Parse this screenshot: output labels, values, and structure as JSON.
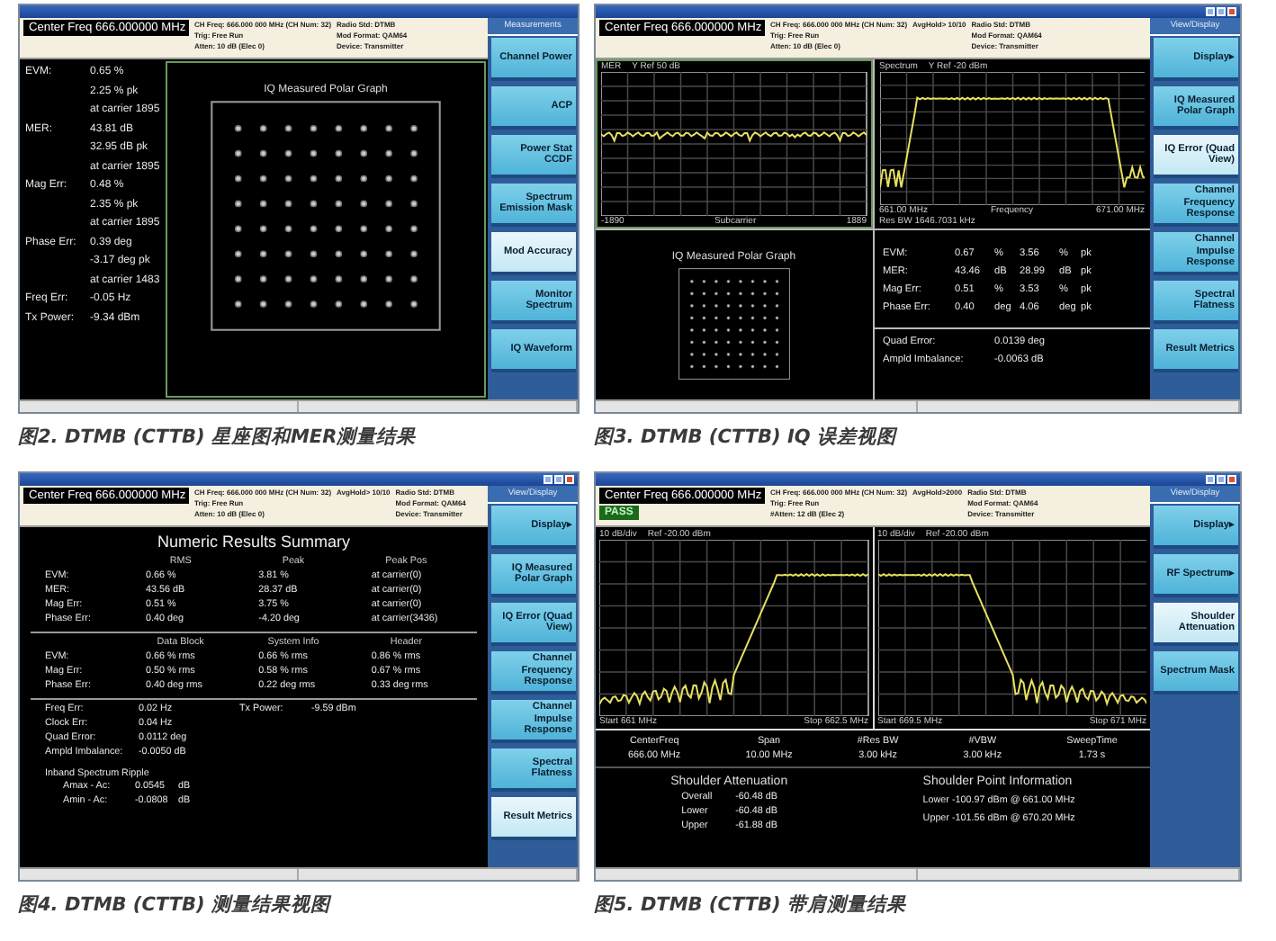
{
  "figures": [
    {
      "caption": "图2. DTMB (CTTB) 星座图和MER测量结果",
      "window_buttons": false,
      "header": {
        "center_freq": "Center Freq  666.000000 MHz",
        "info": [
          [
            "CH Freq: 666.000 000 MHz (CH Num: 32)",
            "Trig: Free Run",
            "Atten: 10 dB (Elec 0)"
          ],
          [
            "Radio Std: DTMB",
            "Mod Format: QAM64",
            "Device: Transmitter"
          ]
        ]
      },
      "softkeys_title": "Measurements",
      "softkeys": [
        {
          "label": "Channel Power",
          "selected": false
        },
        {
          "label": "ACP",
          "selected": false
        },
        {
          "label": "Power Stat CCDF",
          "selected": false
        },
        {
          "label": "Spectrum Emission Mask",
          "selected": false
        },
        {
          "label": "Mod Accuracy",
          "selected": true
        },
        {
          "label": "Monitor Spectrum",
          "selected": false
        },
        {
          "label": "IQ Waveform",
          "selected": false
        }
      ],
      "body": {
        "kind": "mod_accuracy",
        "graph_title": "IQ Measured Polar Graph",
        "metrics": [
          {
            "label": "EVM:",
            "values": [
              "0.65 %",
              "2.25 % pk",
              "at carrier 1895"
            ]
          },
          {
            "label": "MER:",
            "values": [
              "43.81 dB",
              "32.95 dB pk",
              "at carrier 1895"
            ]
          },
          {
            "label": "Mag Err:",
            "values": [
              "0.48 %",
              "2.35 % pk",
              "at carrier 1895"
            ]
          },
          {
            "label": "Phase Err:",
            "values": [
              "0.39 deg",
              "-3.17 deg pk",
              "at carrier 1483"
            ]
          },
          {
            "label": "Freq Err:",
            "values": [
              "-0.05 Hz"
            ]
          },
          {
            "label": "Tx Power:",
            "values": [
              "-9.34 dBm"
            ]
          }
        ]
      }
    },
    {
      "caption": "图3. DTMB (CTTB) IQ 误差视图",
      "window_buttons": true,
      "header": {
        "center_freq": "Center Freq  666.000000 MHz",
        "info": [
          [
            "CH Freq: 666.000 000 MHz (CH Num: 32)",
            "Trig: Free Run",
            "Atten: 10 dB (Elec 0)"
          ],
          [
            "AvgHold> 10/10"
          ],
          [
            "Radio Std: DTMB",
            "Mod Format: QAM64",
            "Device: Transmitter"
          ]
        ]
      },
      "softkeys_title": "View/Display",
      "softkeys": [
        {
          "label": "Display▸",
          "selected": false
        },
        {
          "label": "IQ Measured Polar Graph",
          "selected": false
        },
        {
          "label": "IQ Error (Quad View)",
          "selected": true
        },
        {
          "label": "Channel Frequency Response",
          "selected": false
        },
        {
          "label": "Channel Impulse Response",
          "selected": false
        },
        {
          "label": "Spectral Flatness",
          "selected": false
        },
        {
          "label": "Result Metrics",
          "selected": false
        }
      ],
      "body": {
        "kind": "quad_view",
        "graph_title": "IQ Measured Polar Graph",
        "plots": [
          {
            "title": "MER",
            "ref": "Y Ref 50 dB",
            "x_start": "-1890",
            "x_label": "Subcarrier",
            "x_stop": "1889",
            "kind": "flat"
          },
          {
            "title": "Spectrum",
            "ref": "Y Ref -20 dBm",
            "x_start": "661.00 MHz",
            "x_label": "Frequency",
            "x_stop": "671.00 MHz",
            "footer": "Res BW 1646.7031 kHz",
            "kind": "bandpass"
          }
        ],
        "table": [
          {
            "label": "EVM:",
            "cells": [
              "0.67",
              "%",
              "3.56",
              "%",
              "pk"
            ]
          },
          {
            "label": "MER:",
            "cells": [
              "43.46",
              "dB",
              "28.99",
              "dB",
              "pk"
            ]
          },
          {
            "label": "Mag Err:",
            "cells": [
              "0.51",
              "%",
              "3.53",
              "%",
              "pk"
            ]
          },
          {
            "label": "Phase Err:",
            "cells": [
              "0.40",
              "deg",
              "4.06",
              "deg",
              "pk"
            ]
          }
        ],
        "extra": [
          {
            "label": "Quad Error:",
            "value": "0.0139 deg"
          },
          {
            "label": "Ampld Imbalance:",
            "value": "-0.0063 dB"
          }
        ]
      }
    },
    {
      "caption": "图4. DTMB (CTTB) 测量结果视图",
      "window_buttons": true,
      "header": {
        "center_freq": "Center Freq  666.000000 MHz",
        "info": [
          [
            "CH Freq: 666.000 000 MHz (CH Num: 32)",
            "Trig: Free Run",
            "Atten: 10 dB (Elec 0)"
          ],
          [
            "AvgHold> 10/10"
          ],
          [
            "Radio Std: DTMB",
            "Mod Format: QAM64",
            "Device: Transmitter"
          ]
        ]
      },
      "softkeys_title": "View/Display",
      "softkeys": [
        {
          "label": "Display▸",
          "selected": false
        },
        {
          "label": "IQ Measured Polar Graph",
          "selected": false
        },
        {
          "label": "IQ Error (Quad View)",
          "selected": false
        },
        {
          "label": "Channel Frequency Response",
          "selected": false
        },
        {
          "label": "Channel Impulse Response",
          "selected": false
        },
        {
          "label": "Spectral Flatness",
          "selected": false
        },
        {
          "label": "Result Metrics",
          "selected": true
        }
      ],
      "body": {
        "kind": "summary",
        "title": "Numeric Results Summary",
        "tables": [
          {
            "columns": [
              "RMS",
              "Peak",
              "Peak Pos"
            ],
            "rows": [
              {
                "label": "EVM:",
                "cells": [
                  "0.66  %",
                  "3.81  %",
                  "at carrier(0)"
                ]
              },
              {
                "label": "MER:",
                "cells": [
                  "43.56  dB",
                  "28.37  dB",
                  "at carrier(0)"
                ]
              },
              {
                "label": "Mag Err:",
                "cells": [
                  "0.51  %",
                  "3.75  %",
                  "at carrier(0)"
                ]
              },
              {
                "label": "Phase Err:",
                "cells": [
                  "0.40  deg",
                  "-4.20  deg",
                  "at carrier(3436)"
                ]
              }
            ]
          },
          {
            "columns": [
              "Data Block",
              "System Info",
              "Header"
            ],
            "rows": [
              {
                "label": "EVM:",
                "cells": [
                  "0.66  % rms",
                  "0.66  % rms",
                  "0.86  % rms"
                ]
              },
              {
                "label": "Mag Err:",
                "cells": [
                  "0.50  % rms",
                  "0.58  % rms",
                  "0.67  % rms"
                ]
              },
              {
                "label": "Phase Err:",
                "cells": [
                  "0.40  deg rms",
                  "0.22  deg rms",
                  "0.33  deg rms"
                ]
              }
            ]
          }
        ],
        "misc": [
          {
            "label": "Freq Err:",
            "value": "0.02 Hz",
            "side_label": "Tx Power:",
            "side_value": "-9.59 dBm"
          },
          {
            "label": "Clock Err:",
            "value": "0.04 Hz"
          },
          {
            "label": "Quad Error:",
            "value": "0.0112 deg"
          },
          {
            "label": "Ampld Imbalance:",
            "value": "-0.0050 dB"
          }
        ],
        "ripple": {
          "title": "Inband Spectrum Ripple",
          "rows": [
            {
              "label": "Amax - Ac:",
              "value": "0.0545",
              "unit": "dB"
            },
            {
              "label": "Amin - Ac:",
              "value": "-0.0808",
              "unit": "dB"
            }
          ]
        }
      }
    },
    {
      "caption": "图5. DTMB (CTTB) 带肩测量结果",
      "window_buttons": true,
      "header": {
        "center_freq": "Center Freq  666.000000 MHz",
        "pass": "PASS",
        "info": [
          [
            "CH Freq: 666.000 000 MHz (CH Num: 32)",
            "Trig: Free Run",
            "#Atten: 12 dB (Elec 2)"
          ],
          [
            "AvgHold>2000"
          ],
          [
            "Radio Std: DTMB",
            "Mod Format: QAM64",
            "Device: Transmitter"
          ]
        ]
      },
      "softkeys_title": "View/Display",
      "softkeys": [
        {
          "label": "Display▸",
          "selected": false
        },
        {
          "label": "RF Spectrum▸",
          "selected": false
        },
        {
          "label": "Shoulder Attenuation",
          "selected": true
        },
        {
          "label": "Spectrum Mask",
          "selected": false
        }
      ],
      "body": {
        "kind": "shoulder",
        "plots": [
          {
            "scale": "10 dB/div",
            "ref": "Ref -20.00 dBm",
            "start": "Start 661 MHz",
            "stop": "Stop 662.5 MHz",
            "kind": "rising"
          },
          {
            "scale": "10 dB/div",
            "ref": "Ref -20.00 dBm",
            "start": "Start 669.5 MHz",
            "stop": "Stop 671 MHz",
            "kind": "falling"
          }
        ],
        "params": [
          {
            "name": "CenterFreq",
            "value": "666.00 MHz"
          },
          {
            "name": "Span",
            "value": "10.00 MHz"
          },
          {
            "name": "#Res BW",
            "value": "3.00 kHz"
          },
          {
            "name": "#VBW",
            "value": "3.00 kHz"
          },
          {
            "name": "SweepTime",
            "value": "1.73 s"
          }
        ],
        "attenuation": {
          "title": "Shoulder Attenuation",
          "rows": [
            {
              "label": "Overall",
              "value": "-60.48 dB"
            },
            {
              "label": "Lower",
              "value": "-60.48 dB"
            },
            {
              "label": "Upper",
              "value": "-61.88 dB"
            }
          ]
        },
        "points": {
          "title": "Shoulder Point Information",
          "rows": [
            "Lower  -100.97 dBm @ 661.00 MHz",
            "Upper  -101.56 dBm @ 670.20 MHz"
          ]
        }
      }
    }
  ]
}
